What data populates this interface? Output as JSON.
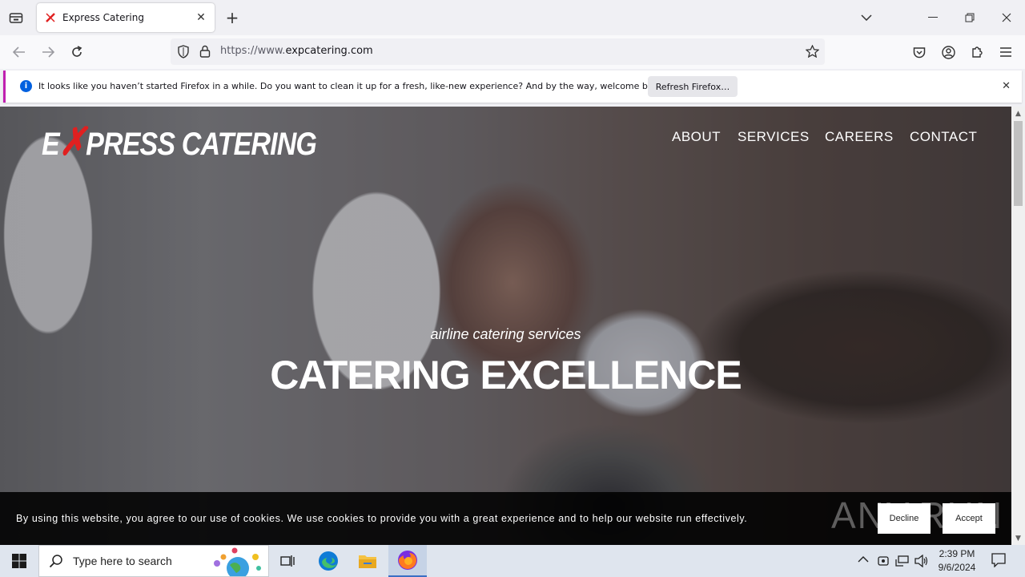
{
  "browser": {
    "tab_title": "Express Catering",
    "url_prefix": "https://www.",
    "url_host": "expcatering.com",
    "notification": {
      "text": "It looks like you haven’t started Firefox in a while. Do you want to clean it up for a fresh, like-new experience? And by the way, welcome back!",
      "button": "Refresh Firefox…"
    }
  },
  "site": {
    "logo_e": "E",
    "logo_rest": "PRESS CATERING",
    "menu": [
      "ABOUT",
      "SERVICES",
      "CAREERS",
      "CONTACT"
    ],
    "hero_subtitle": "airline catering services",
    "hero_title": "CATERING EXCELLENCE"
  },
  "cookie": {
    "text": "By using this website, you agree to our use of cookies. We use cookies to provide you with a great experience and to help our website run effectively.",
    "decline": "Decline",
    "accept": "Accept",
    "watermark": "ANY.RUN"
  },
  "taskbar": {
    "search_placeholder": "Type here to search",
    "time": "2:39 PM",
    "date": "9/6/2024"
  },
  "colors": {
    "logo_accent": "#e02020",
    "notification_accent": "#c020b0",
    "info_blue": "#0060df"
  }
}
